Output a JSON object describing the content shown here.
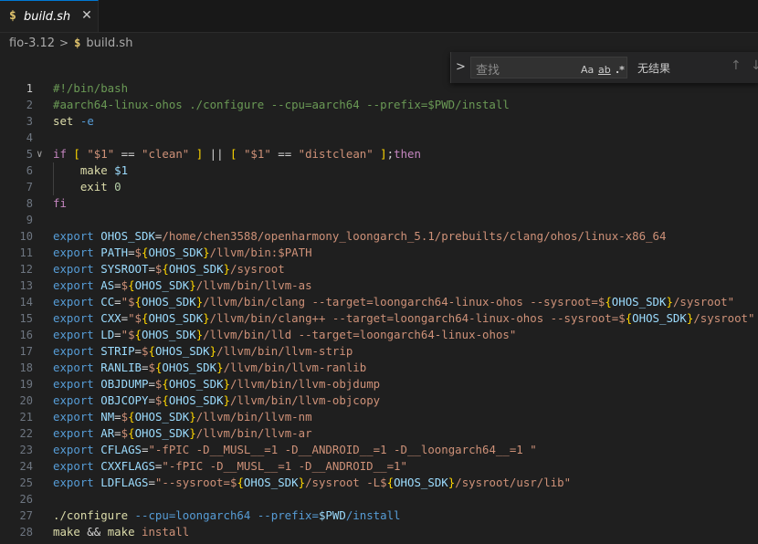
{
  "tab": {
    "icon_text": "$",
    "file_name": "build.sh",
    "close_glyph": "✕"
  },
  "breadcrumb": {
    "folder": "fio-3.12",
    "separator": ">",
    "icon_text": "$",
    "file": "build.sh"
  },
  "find_widget": {
    "toggle_glyph": ">",
    "placeholder": "查找",
    "match_case": "Aa",
    "whole_word": "ab",
    "regex": ".*",
    "result": "无结果",
    "prev_glyph": "↑",
    "next_glyph": "↓"
  },
  "colors": {
    "comment": "#6a9955",
    "keyword": "#c586c0",
    "function": "#dcdcaa",
    "string": "#ce9178",
    "variable": "#9cdcfe",
    "number": "#b5cea8",
    "export": "#569cd6",
    "bracket_gold": "#ffd700",
    "bracket_orchid": "#da70d6"
  },
  "lines": [
    {
      "n": "1",
      "active": true,
      "tokens": [
        [
          "c-comment",
          "#!/bin/bash"
        ]
      ]
    },
    {
      "n": "2",
      "tokens": [
        [
          "c-comment",
          "#aarch64-linux-ohos ./configure --cpu=aarch64 --prefix=$PWD/install"
        ]
      ]
    },
    {
      "n": "3",
      "tokens": [
        [
          "c-fn",
          "set"
        ],
        [
          "c-plain",
          " "
        ],
        [
          "c-export",
          "-e"
        ]
      ]
    },
    {
      "n": "4",
      "tokens": []
    },
    {
      "n": "5",
      "fold": "∨",
      "tokens": [
        [
          "c-kw",
          "if"
        ],
        [
          "c-plain",
          " "
        ],
        [
          "c-brk1",
          "["
        ],
        [
          "c-plain",
          " "
        ],
        [
          "c-str",
          "\"$1\""
        ],
        [
          "c-plain",
          " == "
        ],
        [
          "c-str",
          "\"clean\""
        ],
        [
          "c-plain",
          " "
        ],
        [
          "c-brk1",
          "]"
        ],
        [
          "c-plain",
          " || "
        ],
        [
          "c-brk1",
          "["
        ],
        [
          "c-plain",
          " "
        ],
        [
          "c-str",
          "\"$1\""
        ],
        [
          "c-plain",
          " == "
        ],
        [
          "c-str",
          "\"distclean\""
        ],
        [
          "c-plain",
          " "
        ],
        [
          "c-brk1",
          "]"
        ],
        [
          "c-plain",
          ";"
        ],
        [
          "c-kw",
          "then"
        ]
      ]
    },
    {
      "n": "6",
      "tokens": [
        [
          "c-plain",
          "    "
        ],
        [
          "c-fn",
          "make"
        ],
        [
          "c-plain",
          " "
        ],
        [
          "c-var",
          "$1"
        ]
      ]
    },
    {
      "n": "7",
      "tokens": [
        [
          "c-plain",
          "    "
        ],
        [
          "c-fn",
          "exit"
        ],
        [
          "c-plain",
          " "
        ],
        [
          "c-num",
          "0"
        ]
      ]
    },
    {
      "n": "8",
      "tokens": [
        [
          "c-kw",
          "fi"
        ]
      ]
    },
    {
      "n": "9",
      "tokens": []
    },
    {
      "n": "10",
      "tokens": [
        [
          "c-export",
          "export"
        ],
        [
          "c-plain",
          " "
        ],
        [
          "c-var",
          "OHOS_SDK"
        ],
        [
          "c-plain",
          "="
        ],
        [
          "c-str",
          "/home/chen3588/openharmony_loongarch_5.1/prebuilts/clang/ohos/linux-x86_64"
        ]
      ]
    },
    {
      "n": "11",
      "tokens": [
        [
          "c-export",
          "export"
        ],
        [
          "c-plain",
          " "
        ],
        [
          "c-var",
          "PATH"
        ],
        [
          "c-plain",
          "="
        ],
        [
          "c-str",
          "$"
        ],
        [
          "c-brk1",
          "{"
        ],
        [
          "c-var",
          "OHOS_SDK"
        ],
        [
          "c-brk1",
          "}"
        ],
        [
          "c-str",
          "/llvm/bin:$PATH"
        ]
      ]
    },
    {
      "n": "12",
      "tokens": [
        [
          "c-export",
          "export"
        ],
        [
          "c-plain",
          " "
        ],
        [
          "c-var",
          "SYSROOT"
        ],
        [
          "c-plain",
          "="
        ],
        [
          "c-str",
          "$"
        ],
        [
          "c-brk1",
          "{"
        ],
        [
          "c-var",
          "OHOS_SDK"
        ],
        [
          "c-brk1",
          "}"
        ],
        [
          "c-str",
          "/sysroot"
        ]
      ]
    },
    {
      "n": "13",
      "tokens": [
        [
          "c-export",
          "export"
        ],
        [
          "c-plain",
          " "
        ],
        [
          "c-var",
          "AS"
        ],
        [
          "c-plain",
          "="
        ],
        [
          "c-str",
          "$"
        ],
        [
          "c-brk1",
          "{"
        ],
        [
          "c-var",
          "OHOS_SDK"
        ],
        [
          "c-brk1",
          "}"
        ],
        [
          "c-str",
          "/llvm/bin/llvm-as"
        ]
      ]
    },
    {
      "n": "14",
      "tokens": [
        [
          "c-export",
          "export"
        ],
        [
          "c-plain",
          " "
        ],
        [
          "c-var",
          "CC"
        ],
        [
          "c-plain",
          "="
        ],
        [
          "c-str",
          "\"$"
        ],
        [
          "c-brk1",
          "{"
        ],
        [
          "c-var",
          "OHOS_SDK"
        ],
        [
          "c-brk1",
          "}"
        ],
        [
          "c-str",
          "/llvm/bin/clang --target=loongarch64-linux-ohos --sysroot=$"
        ],
        [
          "c-brk1",
          "{"
        ],
        [
          "c-var",
          "OHOS_SDK"
        ],
        [
          "c-brk1",
          "}"
        ],
        [
          "c-str",
          "/sysroot\""
        ]
      ]
    },
    {
      "n": "15",
      "tokens": [
        [
          "c-export",
          "export"
        ],
        [
          "c-plain",
          " "
        ],
        [
          "c-var",
          "CXX"
        ],
        [
          "c-plain",
          "="
        ],
        [
          "c-str",
          "\"$"
        ],
        [
          "c-brk1",
          "{"
        ],
        [
          "c-var",
          "OHOS_SDK"
        ],
        [
          "c-brk1",
          "}"
        ],
        [
          "c-str",
          "/llvm/bin/clang++ --target=loongarch64-linux-ohos --sysroot=$"
        ],
        [
          "c-brk1",
          "{"
        ],
        [
          "c-var",
          "OHOS_SDK"
        ],
        [
          "c-brk1",
          "}"
        ],
        [
          "c-str",
          "/sysroot\""
        ]
      ]
    },
    {
      "n": "16",
      "tokens": [
        [
          "c-export",
          "export"
        ],
        [
          "c-plain",
          " "
        ],
        [
          "c-var",
          "LD"
        ],
        [
          "c-plain",
          "="
        ],
        [
          "c-str",
          "\"$"
        ],
        [
          "c-brk1",
          "{"
        ],
        [
          "c-var",
          "OHOS_SDK"
        ],
        [
          "c-brk1",
          "}"
        ],
        [
          "c-str",
          "/llvm/bin/lld --target=loongarch64-linux-ohos\""
        ]
      ]
    },
    {
      "n": "17",
      "tokens": [
        [
          "c-export",
          "export"
        ],
        [
          "c-plain",
          " "
        ],
        [
          "c-var",
          "STRIP"
        ],
        [
          "c-plain",
          "="
        ],
        [
          "c-str",
          "$"
        ],
        [
          "c-brk1",
          "{"
        ],
        [
          "c-var",
          "OHOS_SDK"
        ],
        [
          "c-brk1",
          "}"
        ],
        [
          "c-str",
          "/llvm/bin/llvm-strip"
        ]
      ]
    },
    {
      "n": "18",
      "tokens": [
        [
          "c-export",
          "export"
        ],
        [
          "c-plain",
          " "
        ],
        [
          "c-var",
          "RANLIB"
        ],
        [
          "c-plain",
          "="
        ],
        [
          "c-str",
          "$"
        ],
        [
          "c-brk1",
          "{"
        ],
        [
          "c-var",
          "OHOS_SDK"
        ],
        [
          "c-brk1",
          "}"
        ],
        [
          "c-str",
          "/llvm/bin/llvm-ranlib"
        ]
      ]
    },
    {
      "n": "19",
      "tokens": [
        [
          "c-export",
          "export"
        ],
        [
          "c-plain",
          " "
        ],
        [
          "c-var",
          "OBJDUMP"
        ],
        [
          "c-plain",
          "="
        ],
        [
          "c-str",
          "$"
        ],
        [
          "c-brk1",
          "{"
        ],
        [
          "c-var",
          "OHOS_SDK"
        ],
        [
          "c-brk1",
          "}"
        ],
        [
          "c-str",
          "/llvm/bin/llvm-objdump"
        ]
      ]
    },
    {
      "n": "20",
      "tokens": [
        [
          "c-export",
          "export"
        ],
        [
          "c-plain",
          " "
        ],
        [
          "c-var",
          "OBJCOPY"
        ],
        [
          "c-plain",
          "="
        ],
        [
          "c-str",
          "$"
        ],
        [
          "c-brk1",
          "{"
        ],
        [
          "c-var",
          "OHOS_SDK"
        ],
        [
          "c-brk1",
          "}"
        ],
        [
          "c-str",
          "/llvm/bin/llvm-objcopy"
        ]
      ]
    },
    {
      "n": "21",
      "tokens": [
        [
          "c-export",
          "export"
        ],
        [
          "c-plain",
          " "
        ],
        [
          "c-var",
          "NM"
        ],
        [
          "c-plain",
          "="
        ],
        [
          "c-str",
          "$"
        ],
        [
          "c-brk1",
          "{"
        ],
        [
          "c-var",
          "OHOS_SDK"
        ],
        [
          "c-brk1",
          "}"
        ],
        [
          "c-str",
          "/llvm/bin/llvm-nm"
        ]
      ]
    },
    {
      "n": "22",
      "tokens": [
        [
          "c-export",
          "export"
        ],
        [
          "c-plain",
          " "
        ],
        [
          "c-var",
          "AR"
        ],
        [
          "c-plain",
          "="
        ],
        [
          "c-str",
          "$"
        ],
        [
          "c-brk1",
          "{"
        ],
        [
          "c-var",
          "OHOS_SDK"
        ],
        [
          "c-brk1",
          "}"
        ],
        [
          "c-str",
          "/llvm/bin/llvm-ar"
        ]
      ]
    },
    {
      "n": "23",
      "tokens": [
        [
          "c-export",
          "export"
        ],
        [
          "c-plain",
          " "
        ],
        [
          "c-var",
          "CFLAGS"
        ],
        [
          "c-plain",
          "="
        ],
        [
          "c-str",
          "\"-fPIC -D__MUSL__=1 -D__ANDROID__=1 -D__loongarch64__=1 \""
        ]
      ]
    },
    {
      "n": "24",
      "tokens": [
        [
          "c-export",
          "export"
        ],
        [
          "c-plain",
          " "
        ],
        [
          "c-var",
          "CXXFLAGS"
        ],
        [
          "c-plain",
          "="
        ],
        [
          "c-str",
          "\"-fPIC -D__MUSL__=1 -D__ANDROID__=1\""
        ]
      ]
    },
    {
      "n": "25",
      "tokens": [
        [
          "c-export",
          "export"
        ],
        [
          "c-plain",
          " "
        ],
        [
          "c-var",
          "LDFLAGS"
        ],
        [
          "c-plain",
          "="
        ],
        [
          "c-str",
          "\"--sysroot=$"
        ],
        [
          "c-brk1",
          "{"
        ],
        [
          "c-var",
          "OHOS_SDK"
        ],
        [
          "c-brk1",
          "}"
        ],
        [
          "c-str",
          "/sysroot -L$"
        ],
        [
          "c-brk1",
          "{"
        ],
        [
          "c-var",
          "OHOS_SDK"
        ],
        [
          "c-brk1",
          "}"
        ],
        [
          "c-str",
          "/sysroot/usr/lib\""
        ]
      ]
    },
    {
      "n": "26",
      "tokens": []
    },
    {
      "n": "27",
      "tokens": [
        [
          "c-fn",
          "./configure"
        ],
        [
          "c-plain",
          " "
        ],
        [
          "c-export",
          "--cpu=loongarch64"
        ],
        [
          "c-plain",
          " "
        ],
        [
          "c-export",
          "--prefix="
        ],
        [
          "c-var",
          "$PWD"
        ],
        [
          "c-export",
          "/install"
        ]
      ]
    },
    {
      "n": "28",
      "tokens": [
        [
          "c-fn",
          "make"
        ],
        [
          "c-plain",
          " && "
        ],
        [
          "c-fn",
          "make"
        ],
        [
          "c-plain",
          " "
        ],
        [
          "c-str",
          "install"
        ]
      ]
    }
  ]
}
